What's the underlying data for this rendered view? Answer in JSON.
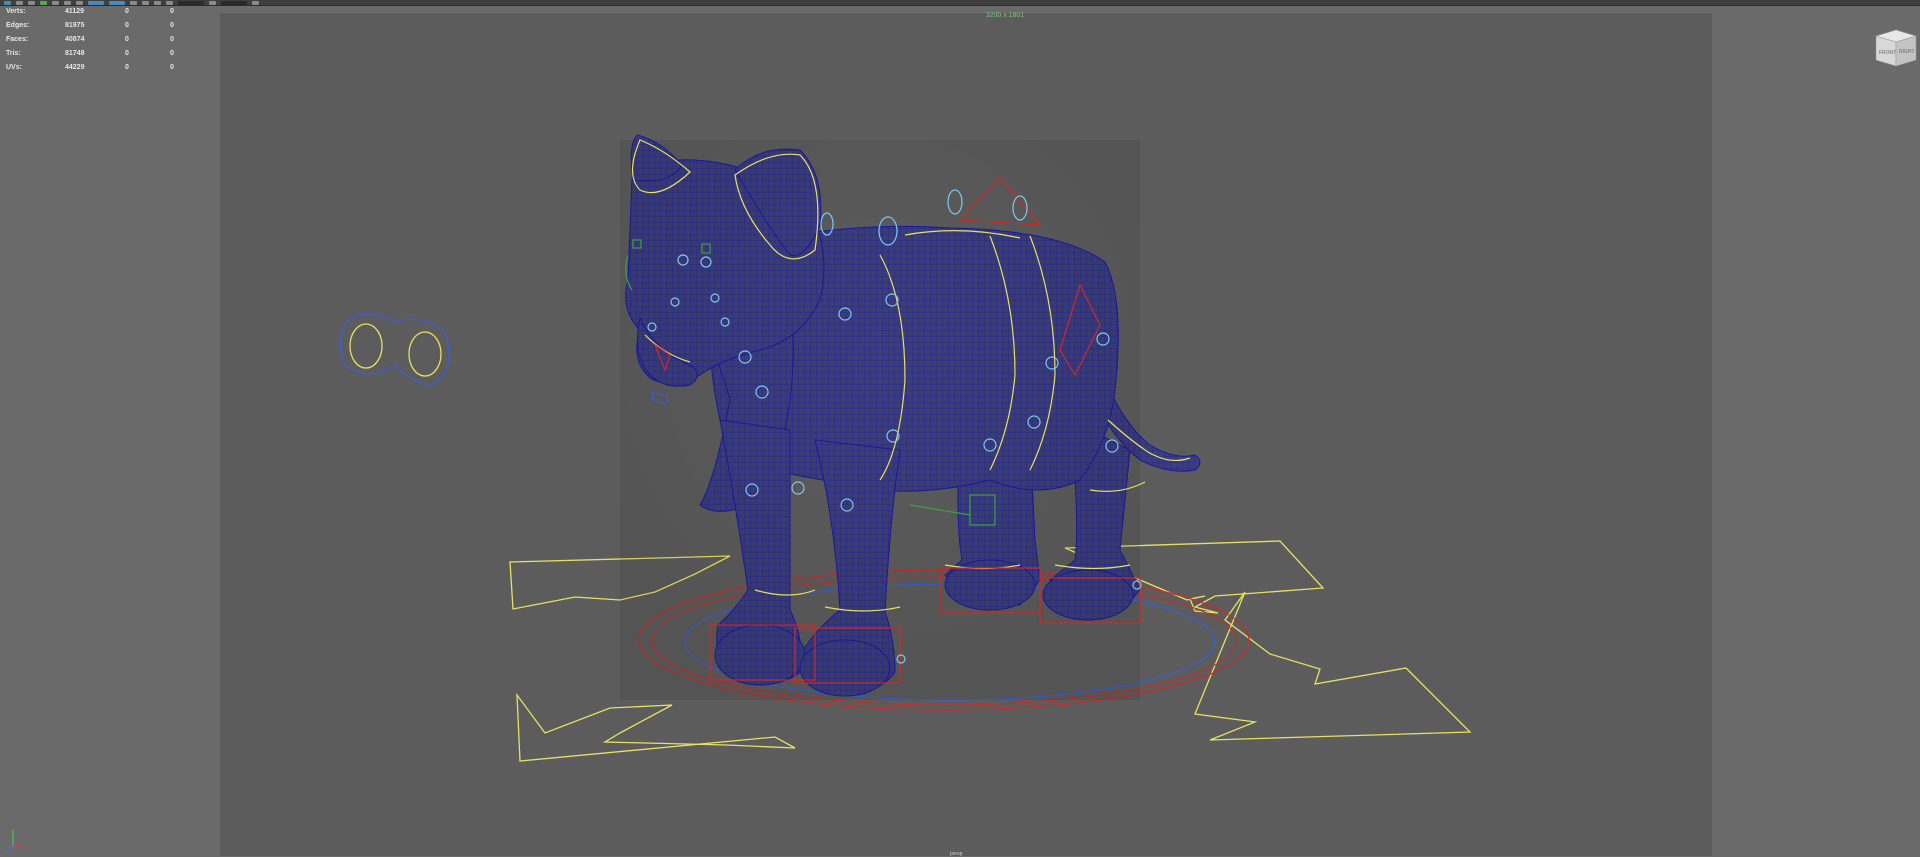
{
  "toolbar": {
    "icons": [
      "select-tool-icon",
      "lasso-tool-icon",
      "move-tool-icon",
      "rotate-tool-icon",
      "scale-tool-icon",
      "camera-icon",
      "grid-icon",
      "wireframe-icon",
      "shaded-icon",
      "textured-icon",
      "lights-icon",
      "shadows-icon",
      "xray-icon",
      "isolate-icon",
      "resolution-gate-icon"
    ]
  },
  "hud": {
    "stats": [
      {
        "label": "Verts:",
        "value": "41129",
        "sel": "0",
        "comp": "0"
      },
      {
        "label": "Edges:",
        "value": "81975",
        "sel": "0",
        "comp": "0"
      },
      {
        "label": "Faces:",
        "value": "40874",
        "sel": "0",
        "comp": "0"
      },
      {
        "label": "Tris:",
        "value": "81748",
        "sel": "0",
        "comp": "0"
      },
      {
        "label": "UVs:",
        "value": "44229",
        "sel": "0",
        "comp": "0"
      }
    ]
  },
  "viewport": {
    "resolution_label": "3200 x 1801",
    "bottom_label": "persp",
    "view_cube": {
      "front": "FRONT",
      "right": "RIGHT"
    },
    "colors": {
      "gate": "#5c5c5c",
      "outside": "#6a6a6a",
      "mesh_fill": "#3c3e6c",
      "wire": "#1c1ca8",
      "ctrl_yellow": "#e8e060",
      "ctrl_red": "#d02828",
      "ctrl_blue": "#3a5ed8",
      "ctrl_cyan": "#7ec8ee",
      "ctrl_green": "#3ea03e"
    }
  }
}
